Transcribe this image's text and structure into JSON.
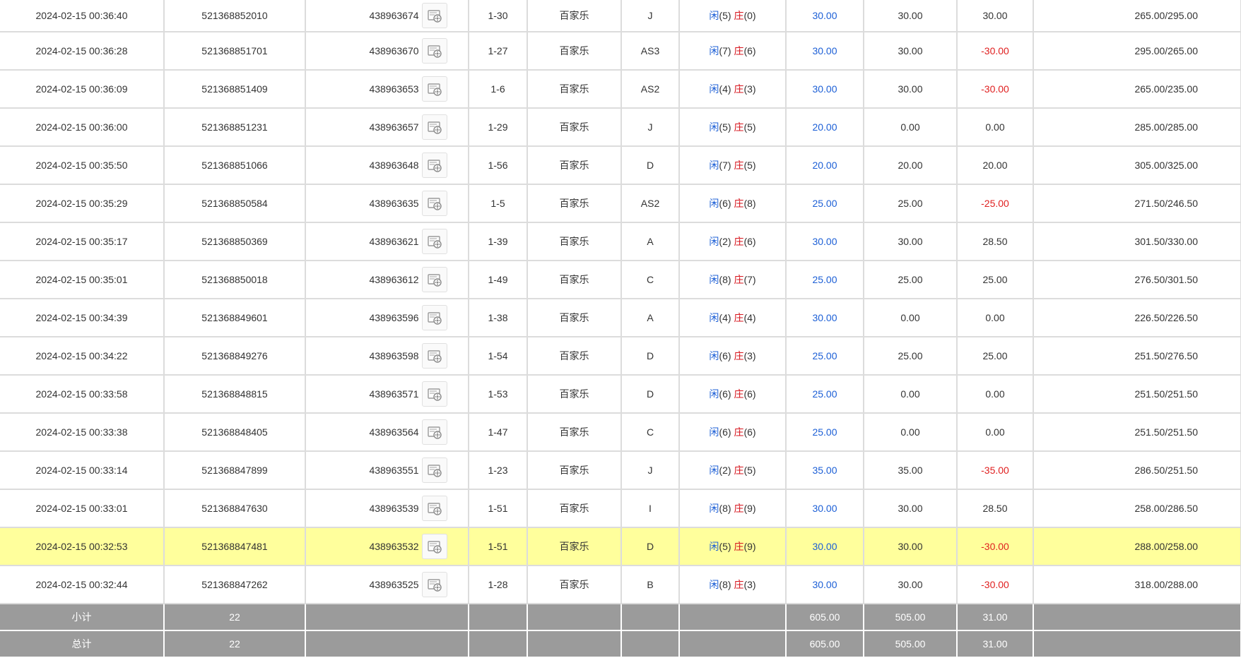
{
  "records": [
    {
      "time": "2024-02-15 00:36:40",
      "order": "521368852010",
      "game": "438963674",
      "table": "1-30",
      "type": "百家乐",
      "bet_on": "J",
      "player_label": "闲",
      "player_pts": "(5)",
      "banker_label": "庄",
      "banker_pts": "(0)",
      "bet": "30.00",
      "valid": "30.00",
      "win": "30.00",
      "win_negative": false,
      "balance": "265.00/295.00",
      "highlight": false
    },
    {
      "time": "2024-02-15 00:36:28",
      "order": "521368851701",
      "game": "438963670",
      "table": "1-27",
      "type": "百家乐",
      "bet_on": "AS3",
      "player_label": "闲",
      "player_pts": "(7)",
      "banker_label": "庄",
      "banker_pts": "(6)",
      "bet": "30.00",
      "valid": "30.00",
      "win": "-30.00",
      "win_negative": true,
      "balance": "295.00/265.00",
      "highlight": false
    },
    {
      "time": "2024-02-15 00:36:09",
      "order": "521368851409",
      "game": "438963653",
      "table": "1-6",
      "type": "百家乐",
      "bet_on": "AS2",
      "player_label": "闲",
      "player_pts": "(4)",
      "banker_label": "庄",
      "banker_pts": "(3)",
      "bet": "30.00",
      "valid": "30.00",
      "win": "-30.00",
      "win_negative": true,
      "balance": "265.00/235.00",
      "highlight": false
    },
    {
      "time": "2024-02-15 00:36:00",
      "order": "521368851231",
      "game": "438963657",
      "table": "1-29",
      "type": "百家乐",
      "bet_on": "J",
      "player_label": "闲",
      "player_pts": "(5)",
      "banker_label": "庄",
      "banker_pts": "(5)",
      "bet": "20.00",
      "valid": "0.00",
      "win": "0.00",
      "win_negative": false,
      "balance": "285.00/285.00",
      "highlight": false
    },
    {
      "time": "2024-02-15 00:35:50",
      "order": "521368851066",
      "game": "438963648",
      "table": "1-56",
      "type": "百家乐",
      "bet_on": "D",
      "player_label": "闲",
      "player_pts": "(7)",
      "banker_label": "庄",
      "banker_pts": "(5)",
      "bet": "20.00",
      "valid": "20.00",
      "win": "20.00",
      "win_negative": false,
      "balance": "305.00/325.00",
      "highlight": false
    },
    {
      "time": "2024-02-15 00:35:29",
      "order": "521368850584",
      "game": "438963635",
      "table": "1-5",
      "type": "百家乐",
      "bet_on": "AS2",
      "player_label": "闲",
      "player_pts": "(6)",
      "banker_label": "庄",
      "banker_pts": "(8)",
      "bet": "25.00",
      "valid": "25.00",
      "win": "-25.00",
      "win_negative": true,
      "balance": "271.50/246.50",
      "highlight": false
    },
    {
      "time": "2024-02-15 00:35:17",
      "order": "521368850369",
      "game": "438963621",
      "table": "1-39",
      "type": "百家乐",
      "bet_on": "A",
      "player_label": "闲",
      "player_pts": "(2)",
      "banker_label": "庄",
      "banker_pts": "(6)",
      "bet": "30.00",
      "valid": "30.00",
      "win": "28.50",
      "win_negative": false,
      "balance": "301.50/330.00",
      "highlight": false
    },
    {
      "time": "2024-02-15 00:35:01",
      "order": "521368850018",
      "game": "438963612",
      "table": "1-49",
      "type": "百家乐",
      "bet_on": "C",
      "player_label": "闲",
      "player_pts": "(8)",
      "banker_label": "庄",
      "banker_pts": "(7)",
      "bet": "25.00",
      "valid": "25.00",
      "win": "25.00",
      "win_negative": false,
      "balance": "276.50/301.50",
      "highlight": false
    },
    {
      "time": "2024-02-15 00:34:39",
      "order": "521368849601",
      "game": "438963596",
      "table": "1-38",
      "type": "百家乐",
      "bet_on": "A",
      "player_label": "闲",
      "player_pts": "(4)",
      "banker_label": "庄",
      "banker_pts": "(4)",
      "bet": "30.00",
      "valid": "0.00",
      "win": "0.00",
      "win_negative": false,
      "balance": "226.50/226.50",
      "highlight": false
    },
    {
      "time": "2024-02-15 00:34:22",
      "order": "521368849276",
      "game": "438963598",
      "table": "1-54",
      "type": "百家乐",
      "bet_on": "D",
      "player_label": "闲",
      "player_pts": "(6)",
      "banker_label": "庄",
      "banker_pts": "(3)",
      "bet": "25.00",
      "valid": "25.00",
      "win": "25.00",
      "win_negative": false,
      "balance": "251.50/276.50",
      "highlight": false
    },
    {
      "time": "2024-02-15 00:33:58",
      "order": "521368848815",
      "game": "438963571",
      "table": "1-53",
      "type": "百家乐",
      "bet_on": "D",
      "player_label": "闲",
      "player_pts": "(6)",
      "banker_label": "庄",
      "banker_pts": "(6)",
      "bet": "25.00",
      "valid": "0.00",
      "win": "0.00",
      "win_negative": false,
      "balance": "251.50/251.50",
      "highlight": false
    },
    {
      "time": "2024-02-15 00:33:38",
      "order": "521368848405",
      "game": "438963564",
      "table": "1-47",
      "type": "百家乐",
      "bet_on": "C",
      "player_label": "闲",
      "player_pts": "(6)",
      "banker_label": "庄",
      "banker_pts": "(6)",
      "bet": "25.00",
      "valid": "0.00",
      "win": "0.00",
      "win_negative": false,
      "balance": "251.50/251.50",
      "highlight": false
    },
    {
      "time": "2024-02-15 00:33:14",
      "order": "521368847899",
      "game": "438963551",
      "table": "1-23",
      "type": "百家乐",
      "bet_on": "J",
      "player_label": "闲",
      "player_pts": "(2)",
      "banker_label": "庄",
      "banker_pts": "(5)",
      "bet": "35.00",
      "valid": "35.00",
      "win": "-35.00",
      "win_negative": true,
      "balance": "286.50/251.50",
      "highlight": false
    },
    {
      "time": "2024-02-15 00:33:01",
      "order": "521368847630",
      "game": "438963539",
      "table": "1-51",
      "type": "百家乐",
      "bet_on": "I",
      "player_label": "闲",
      "player_pts": "(8)",
      "banker_label": "庄",
      "banker_pts": "(9)",
      "bet": "30.00",
      "valid": "30.00",
      "win": "28.50",
      "win_negative": false,
      "balance": "258.00/286.50",
      "highlight": false
    },
    {
      "time": "2024-02-15 00:32:53",
      "order": "521368847481",
      "game": "438963532",
      "table": "1-51",
      "type": "百家乐",
      "bet_on": "D",
      "player_label": "闲",
      "player_pts": "(5)",
      "banker_label": "庄",
      "banker_pts": "(9)",
      "bet": "30.00",
      "valid": "30.00",
      "win": "-30.00",
      "win_negative": true,
      "balance": "288.00/258.00",
      "highlight": true
    },
    {
      "time": "2024-02-15 00:32:44",
      "order": "521368847262",
      "game": "438963525",
      "table": "1-28",
      "type": "百家乐",
      "bet_on": "B",
      "player_label": "闲",
      "player_pts": "(8)",
      "banker_label": "庄",
      "banker_pts": "(3)",
      "bet": "30.00",
      "valid": "30.00",
      "win": "-30.00",
      "win_negative": true,
      "balance": "318.00/288.00",
      "highlight": false
    }
  ],
  "summary": [
    {
      "label": "小计",
      "count": "22",
      "bet": "605.00",
      "valid": "505.00",
      "win": "31.00"
    },
    {
      "label": "总计",
      "count": "22",
      "bet": "605.00",
      "valid": "505.00",
      "win": "31.00"
    }
  ],
  "icons": {
    "replay": "video-replay-icon"
  },
  "colors": {
    "player": "#1c5fd6",
    "banker": "#d6141c",
    "negative": "#e02020",
    "highlight_row": "#ffff9c",
    "summary_bg": "#9b9b9b"
  }
}
